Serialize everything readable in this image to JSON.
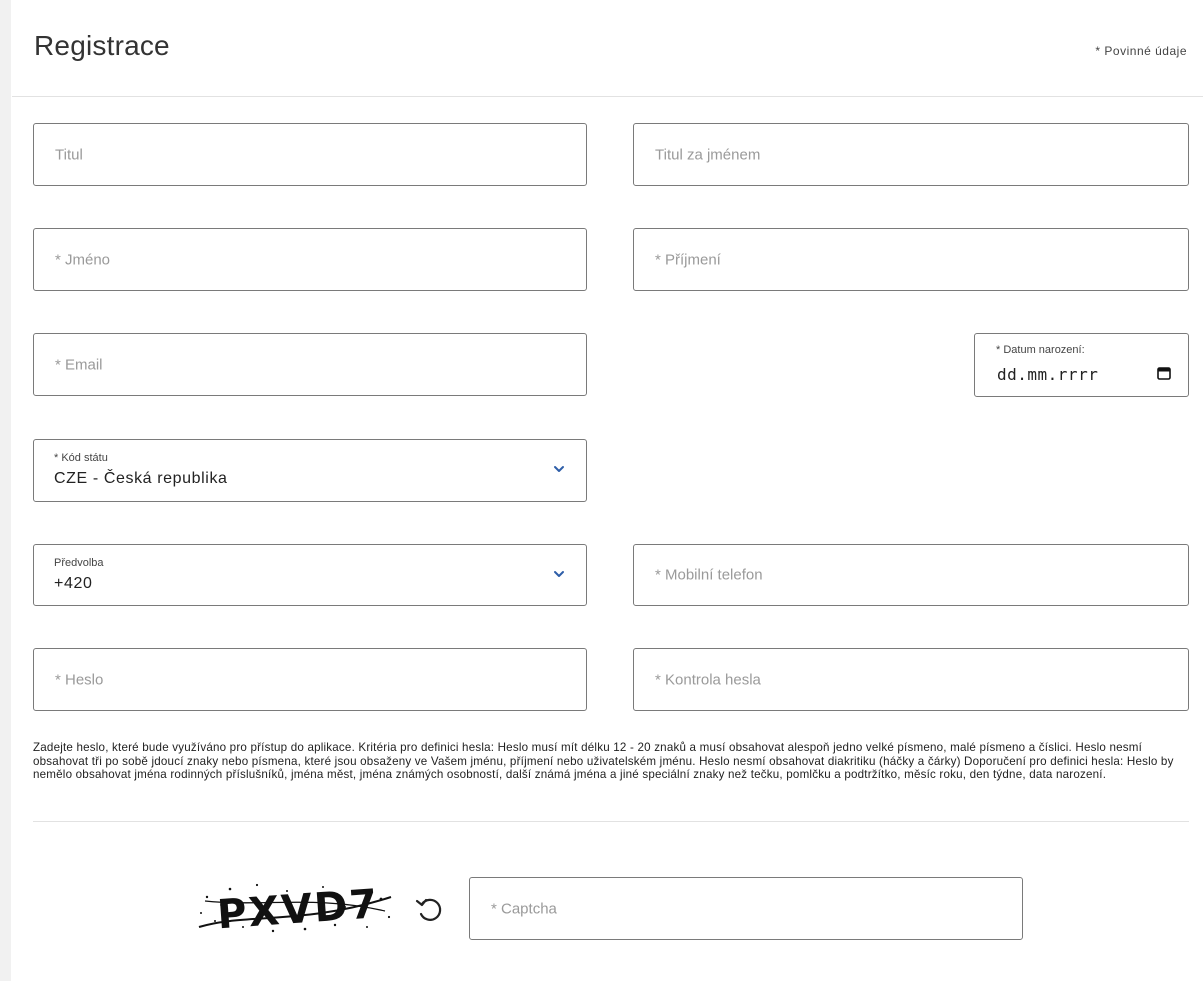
{
  "header": {
    "title": "Registrace",
    "required_note": "* Povinné údaje"
  },
  "form": {
    "title_before": {
      "placeholder": "Titul"
    },
    "title_after": {
      "placeholder": "Titul za jménem"
    },
    "first_name": {
      "placeholder": "* Jméno"
    },
    "last_name": {
      "placeholder": "* Příjmení"
    },
    "email": {
      "placeholder": "* Email"
    },
    "birth_date": {
      "label": "* Datum narození:",
      "value": "dd.mm.rrrr"
    },
    "country_code": {
      "label": "* Kód státu",
      "value": "CZE - Česká republika"
    },
    "phone_prefix": {
      "label": "Předvolba",
      "value": "+420"
    },
    "mobile_phone": {
      "placeholder": "* Mobilní telefon"
    },
    "password": {
      "placeholder": "* Heslo"
    },
    "password_confirm": {
      "placeholder": "* Kontrola hesla"
    },
    "password_help": "Zadejte heslo, které bude využíváno pro přístup do aplikace. Kritéria pro definici hesla: Heslo musí mít délku 12 - 20 znaků a musí obsahovat alespoň jedno velké písmeno, malé písmeno a číslici. Heslo nesmí obsahovat tři po sobě jdoucí znaky nebo písmena, které jsou obsaženy ve Vašem jménu, příjmení nebo uživatelském jménu. Heslo nesmí obsahovat diakritiku (háčky a čárky) Doporučení pro definici hesla: Heslo by nemělo obsahovat jména rodinných příslušníků, jména měst, jména známých osobností, další známá jména a jiné speciální znaky než tečku, pomlčku a podtržítko, měsíc roku, den týdne, data narození.",
    "captcha": {
      "image_text": "PXVD7",
      "placeholder": "* Captcha",
      "refresh_icon": "refresh-icon"
    }
  },
  "colors": {
    "border": "#7a7a7a",
    "placeholder": "#9a9a9a",
    "chevron": "#2e5ea8"
  }
}
